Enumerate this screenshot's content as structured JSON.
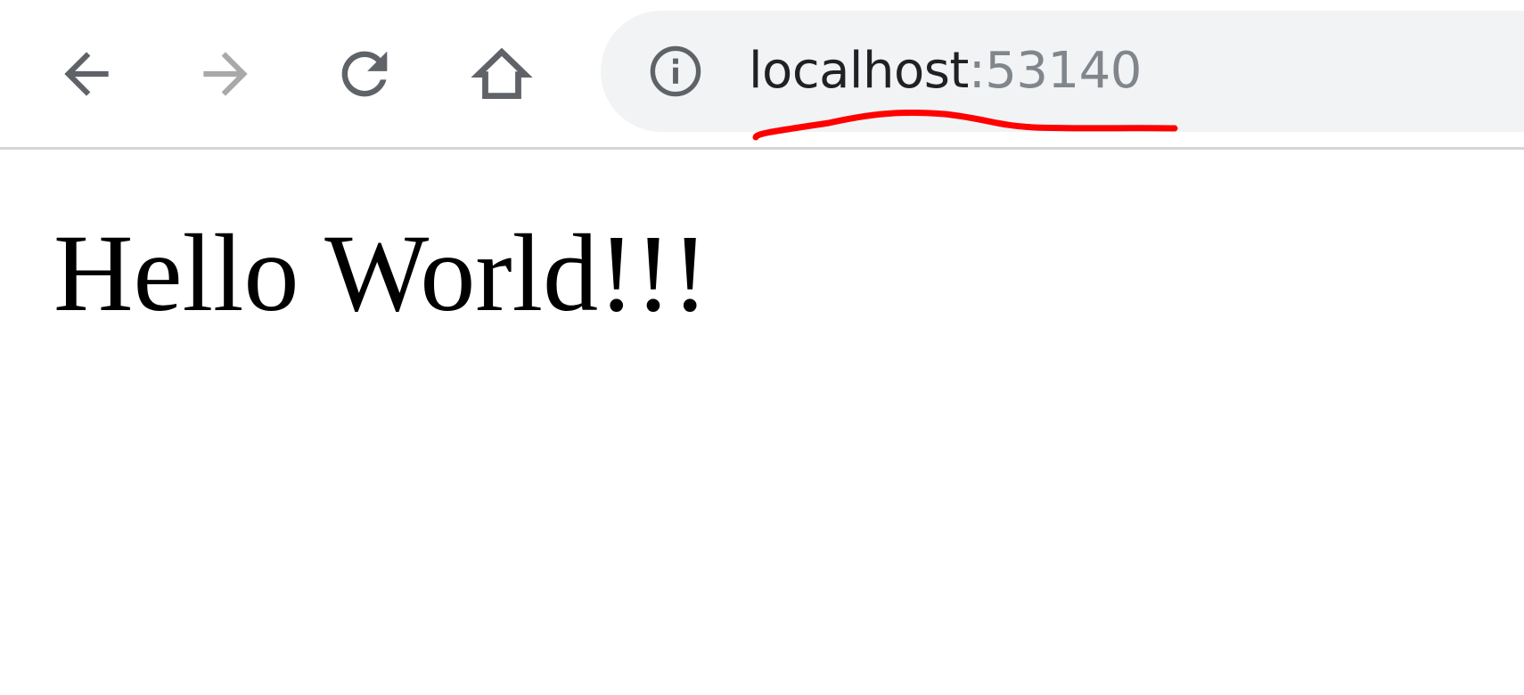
{
  "toolbar": {
    "icons": {
      "back": "arrow-left-icon",
      "forward": "arrow-right-icon",
      "reload": "reload-icon",
      "home": "home-icon",
      "site_info": "info-icon"
    },
    "address_bar": {
      "host": "localhost",
      "port_separator": ":",
      "port": "53140"
    }
  },
  "annotation": {
    "type": "hand-drawn underline",
    "color": "#ff0000"
  },
  "page": {
    "heading": "Hello World!!!"
  },
  "colors": {
    "icon_active": "#5f6368",
    "icon_disabled": "#a9a9a9",
    "omnibox_bg": "#f1f3f4",
    "url_host": "#202124",
    "url_port": "#80868b"
  }
}
